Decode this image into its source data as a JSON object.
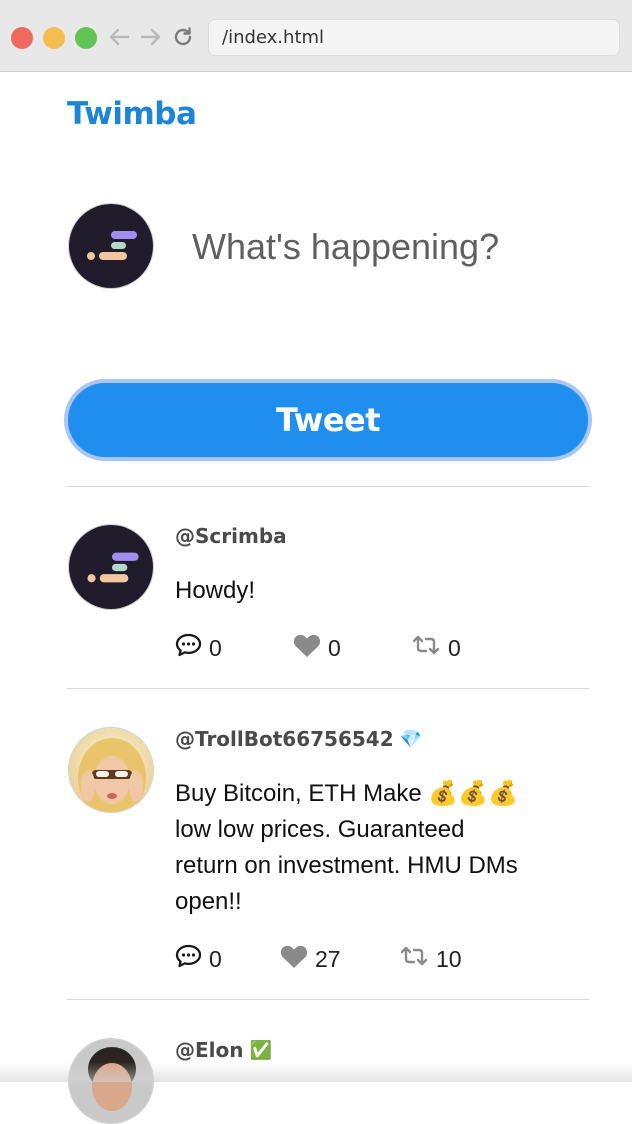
{
  "browser": {
    "url": "/index.html"
  },
  "app": {
    "logo": "Twimba",
    "accent_color": "#1d84d8",
    "composer": {
      "placeholder": "What's happening?",
      "tweet_button": "Tweet"
    }
  },
  "tweets": [
    {
      "handle": "@Scrimba",
      "badge": "",
      "text": "Howdy!",
      "replies": "0",
      "likes": "0",
      "retweets": "0",
      "avatar": "scrimba-logo"
    },
    {
      "handle": "@TrollBot66756542",
      "badge": "💎",
      "text": "Buy Bitcoin, ETH Make 💰💰💰\nlow low prices. Guaranteed\nreturn on investment. HMU DMs\nopen!!",
      "replies": "0",
      "likes": "27",
      "retweets": "10",
      "avatar": "troll-bot-photo"
    },
    {
      "handle": "@Elon",
      "badge": "✅",
      "avatar": "elon-photo"
    }
  ]
}
